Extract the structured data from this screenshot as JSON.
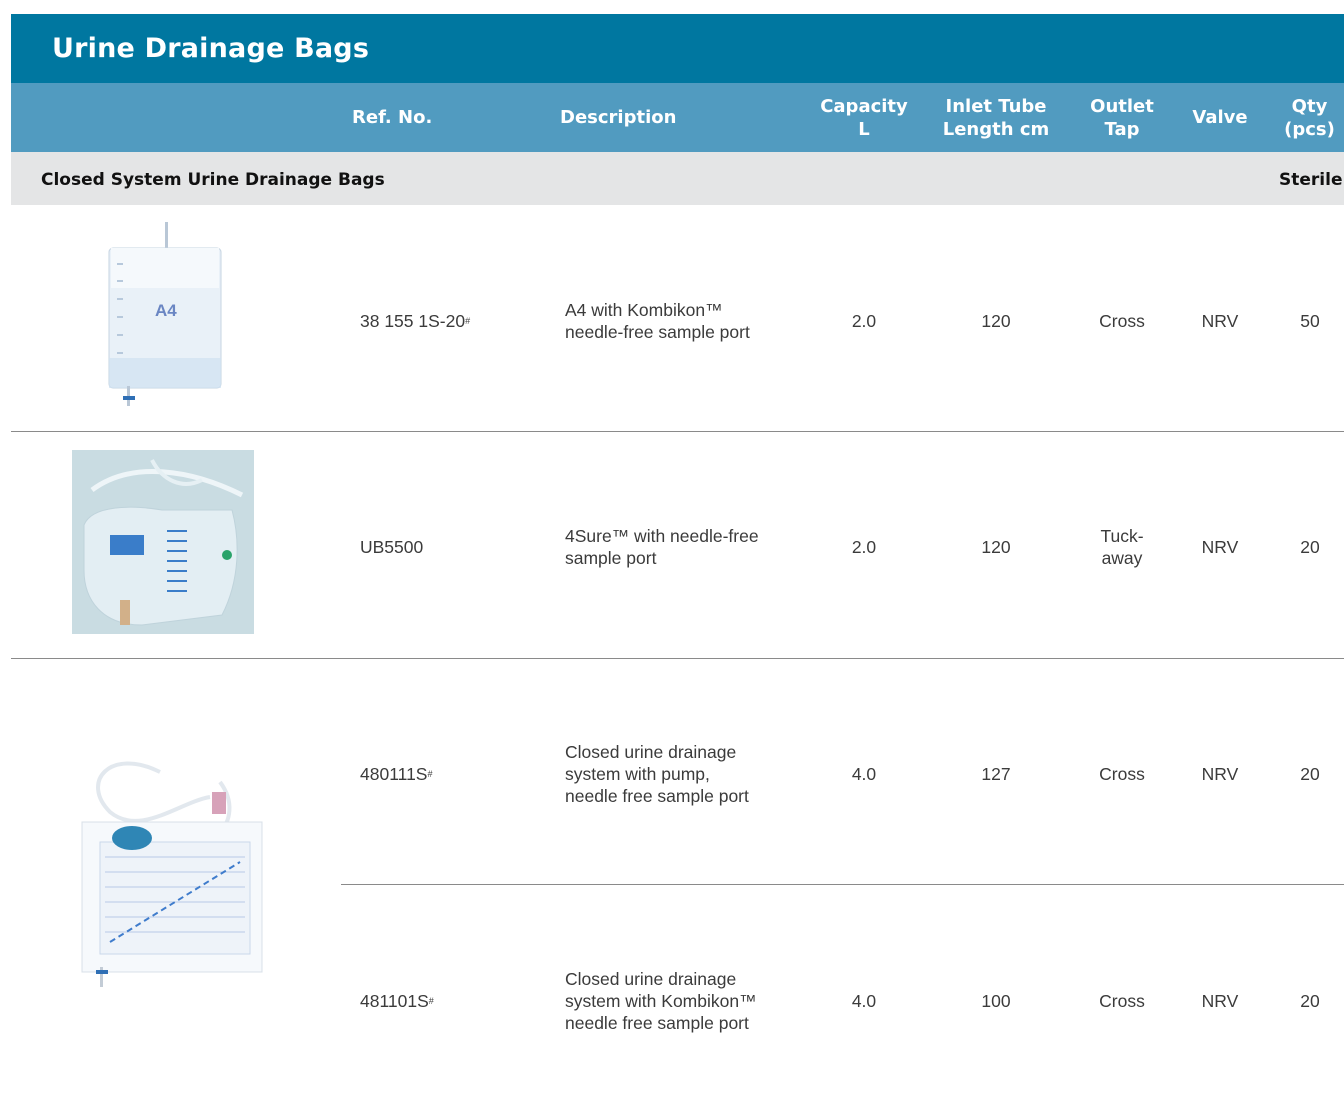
{
  "title": "Urine Drainage Bags",
  "columns": {
    "ref": "Ref. No.",
    "description": "Description",
    "capacity": "Capacity\nL",
    "inlet": "Inlet Tube\nLength cm",
    "outlet": "Outlet\nTap",
    "valve": "Valve",
    "qty": "Qty\n(pcs)"
  },
  "section": {
    "title": "Closed System Urine Drainage Bags",
    "sterile": "Sterile"
  },
  "rows": [
    {
      "ref": "38 155 1S-20",
      "ref_mark": "#",
      "description": "A4 with Kombikon™\nneedle-free sample port",
      "capacity": "2.0",
      "inlet": "120",
      "outlet": "Cross",
      "valve": "NRV",
      "qty": "50"
    },
    {
      "ref": "UB5500",
      "ref_mark": "",
      "description": "4Sure™ with needle-free\nsample port",
      "capacity": "2.0",
      "inlet": "120",
      "outlet": "Tuck-\naway",
      "valve": "NRV",
      "qty": "20"
    },
    {
      "ref": "480111S",
      "ref_mark": "#",
      "description": "Closed urine drainage\nsystem with pump,\nneedle free sample port",
      "capacity": "4.0",
      "inlet": "127",
      "outlet": "Cross",
      "valve": "NRV",
      "qty": "20"
    },
    {
      "ref": "481101S",
      "ref_mark": "#",
      "description": "Closed urine drainage\nsystem with Kombikon™\nneedle free sample port",
      "capacity": "4.0",
      "inlet": "100",
      "outlet": "Cross",
      "valve": "NRV",
      "qty": "20"
    }
  ],
  "images": {
    "a4_bag_label": "A4"
  },
  "colors": {
    "title_bg": "#0077a0",
    "header_bg": "#519bc0",
    "section_bg": "#e4e5e6"
  }
}
